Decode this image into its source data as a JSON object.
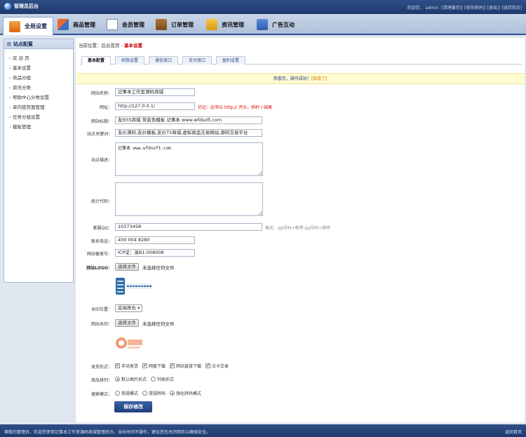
{
  "header": {
    "title": "管理员后台",
    "welcome": "欢迎您，",
    "user": "admin",
    "links": [
      "[清理缓存]",
      "[修改密码]",
      "[退出]",
      "[返回首页]"
    ]
  },
  "nav": {
    "items": [
      {
        "label": "全局设置",
        "active": true
      },
      {
        "label": "商品管理"
      },
      {
        "label": "会员管理"
      },
      {
        "label": "订单管理"
      },
      {
        "label": "资讯管理"
      },
      {
        "label": "广告互动"
      }
    ]
  },
  "sidebar": {
    "title": "站点配置",
    "items": [
      "欢 迎 页",
      "基本设置",
      "商品分组",
      "资讯分类",
      "帮助中心分类设置",
      "单内容页面管理",
      "任务分组设置",
      "模板管理"
    ]
  },
  "breadcrumb": {
    "prefix": "当前位置：后台首页",
    "sep": " - ",
    "current": "基本设置"
  },
  "tabs": [
    "基本配置",
    "权限设置",
    "通信接口",
    "支付接口",
    "盈利设置"
  ],
  "notice": {
    "text": "恭喜您，操作成功！",
    "link": "[知道了]"
  },
  "form": {
    "site_name": {
      "label": "网站名称：",
      "value": "记事本工作室源码商城"
    },
    "site_url": {
      "label": "网址：",
      "value": "http://127.0.0.1/",
      "hint": "切记：必须以 http:// 开头，斜杆 / 结尾"
    },
    "site_title": {
      "label": "网站标题：",
      "value": "友价t5商城 带蓝色模板 记事本 www.wfdsoft.com"
    },
    "keywords": {
      "label": "站点关键词：",
      "value": "友价源码,友价模板,友价T5商城,虚拟商品交易网站,源码交易平台"
    },
    "description": {
      "label": "站点描述：",
      "value": "记事本 www.wfdsoft.com"
    },
    "stats_code": {
      "label": "统计代码：",
      "value": ""
    },
    "qq": {
      "label": "客服QQ：",
      "value": "10373458",
      "hint": "格式：qq号码+称呼,qq号码+称呼"
    },
    "phone": {
      "label": "联系电话：",
      "value": "400 004 8280"
    },
    "icp": {
      "label": "网站备案号：",
      "value": "ICP证：浙B1-008008"
    },
    "logo": {
      "label": "网站LOGO：",
      "button": "选择文件",
      "status": "未选择任何文件"
    },
    "watermark_pos": {
      "label": "水印位置：",
      "value": "底端居右"
    },
    "watermark": {
      "label": "网站水印：",
      "button": "选择文件",
      "status": "未选择任何文件"
    },
    "delivery": {
      "label": "发货形式：",
      "options": [
        "手动发货",
        "网盘下载",
        "网站直接下载",
        "点卡交易"
      ]
    },
    "product_layout": {
      "label": "商品排列：",
      "options": [
        "默认图片形式",
        "列表形式"
      ],
      "selected": 0
    },
    "search_mode": {
      "label": "搜索模式：",
      "options": [
        "常规模式",
        "常规转码",
        "强化转码模式"
      ],
      "selected": 2
    },
    "save": "保存修改"
  },
  "footer": {
    "left": "尊敬的管理员，欢迎您使用记事本工作室源码商城管理后台，当长时间不操作，建议您先关闭网页以确保安全。",
    "right": "返回首页"
  },
  "colors": {
    "header": "#1e3a6e",
    "accent": "#2f5496",
    "notice_bg": "#fffbd1"
  }
}
